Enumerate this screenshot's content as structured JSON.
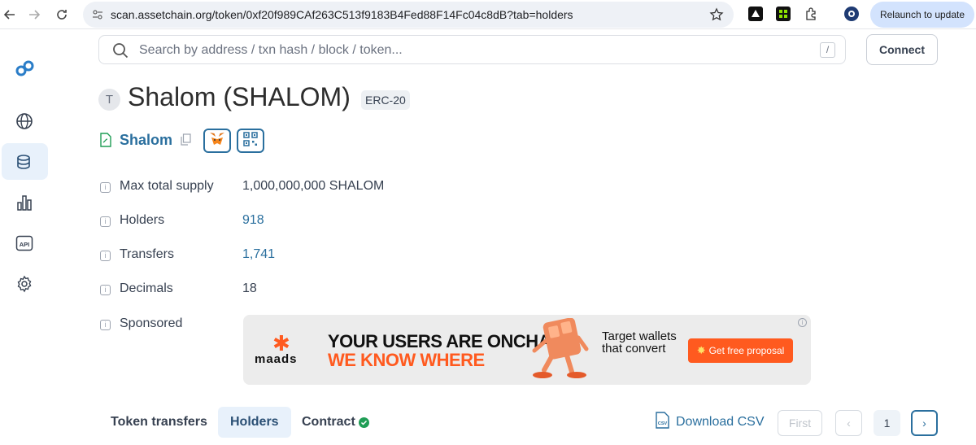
{
  "browser": {
    "url": "scan.assetchain.org/token/0xf20f989CAf263C513f9183B4Fed88F14Fc04c8dB?tab=holders",
    "relaunch_label": "Relaunch to update"
  },
  "search": {
    "placeholder": "Search by address / txn hash / block / token...",
    "shortcut": "/"
  },
  "header": {
    "connect_label": "Connect"
  },
  "token": {
    "avatar_letter": "T",
    "title": "Shalom (SHALOM)",
    "standard_badge": "ERC-20",
    "contract_name": "Shalom"
  },
  "details": [
    {
      "label": "Max total supply",
      "value": "1,000,000,000 SHALOM",
      "link": false
    },
    {
      "label": "Holders",
      "value": "918",
      "link": true
    },
    {
      "label": "Transfers",
      "value": "1,741",
      "link": true
    },
    {
      "label": "Decimals",
      "value": "18",
      "link": false
    },
    {
      "label": "Sponsored",
      "value": "",
      "link": false
    }
  ],
  "ad": {
    "brand": "maads",
    "headline_1": "YOUR USERS ARE ONCHAIN.",
    "headline_2": "WE KNOW WHERE",
    "side_text": "Target wallets that convert",
    "cta": "Get free proposal"
  },
  "tabs": [
    {
      "label": "Token transfers",
      "active": false
    },
    {
      "label": "Holders",
      "active": true
    },
    {
      "label": "Contract",
      "active": false,
      "verified": true
    }
  ],
  "toolbar": {
    "download_csv": "Download CSV"
  },
  "pagination": {
    "first": "First",
    "prev": "‹",
    "current": "1",
    "next": "›"
  },
  "colors": {
    "link": "#2a6f9e",
    "accent": "#ff5a1f",
    "active_bg": "#e8f1fb"
  }
}
